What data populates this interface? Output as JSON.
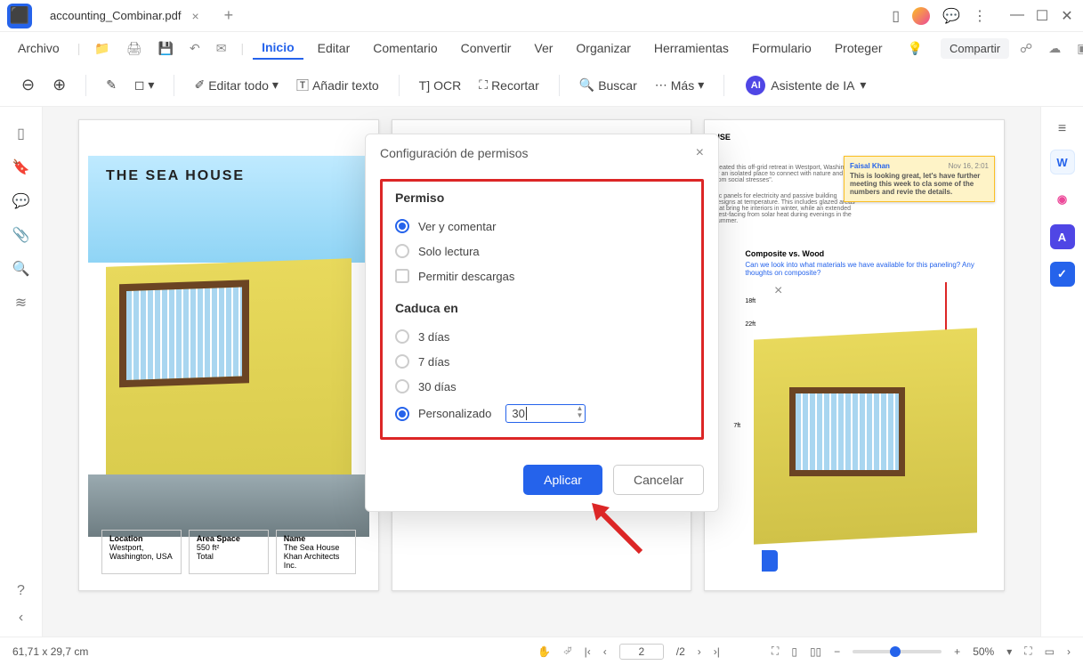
{
  "title": "accounting_Combinar.pdf",
  "file_menu": "Archivo",
  "menu": {
    "inicio": "Inicio",
    "editar": "Editar",
    "comentario": "Comentario",
    "convertir": "Convertir",
    "ver": "Ver",
    "organizar": "Organizar",
    "herramientas": "Herramientas",
    "formulario": "Formulario",
    "proteger": "Proteger",
    "compartir": "Compartir"
  },
  "toolbar": {
    "editar_todo": "Editar todo",
    "anadir_texto": "Añadir texto",
    "ocr": "OCR",
    "recortar": "Recortar",
    "buscar": "Buscar",
    "mas": "Más",
    "asistente": "Asistente de IA"
  },
  "dialog": {
    "title": "Configuración de permisos",
    "permiso": "Permiso",
    "ver_comentar": "Ver y comentar",
    "solo_lectura": "Solo lectura",
    "permitir_descargas": "Permitir descargas",
    "caduca": "Caduca en",
    "d3": "3 días",
    "d7": "7 días",
    "d30": "30 días",
    "personalizado": "Personalizado",
    "custom_value": "30",
    "aplicar": "Aplicar",
    "cancelar": "Cancelar"
  },
  "share_hint": "Comp",
  "doc_info": {
    "sea_house": "THE SEA HOUSE",
    "use": "USE",
    "loc_label": "Location",
    "loc_val": "Westport,\nWashington, USA",
    "area_label": "Area Space",
    "area_val": "550 ft²\nTotal",
    "name_label": "Name",
    "name_val": "The Sea House\nKhan Architects Inc.",
    "desc1": "created this off-grid retreat in Westport, Washington or an isolated place to connect with nature and from social stresses\".",
    "desc2": "aic panels for electricity and passive building designs at temperature. This includes glazed areas that bring he interiors in winter, while an extended west-facing from solar heat during evenings in the summer.",
    "sticky_author": "Faisal Khan",
    "sticky_date": "Nov 16, 2:01",
    "sticky_body": "This is looking great, let's have further meeting this week to cla some of the numbers and revie the details.",
    "annot_title": "Composite vs. Wood",
    "annot_body": "Can we look into what materials we have available for this paneling? Any thoughts on composite?",
    "dim18": "18ft",
    "dim22": "22ft",
    "dim7": "7ft"
  },
  "status": {
    "dims": "61,71 x 29,7 cm",
    "page": "2",
    "pages": "/2",
    "zoom": "50%"
  }
}
